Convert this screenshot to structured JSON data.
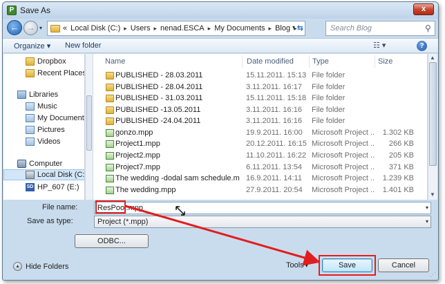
{
  "window": {
    "title": "Save As",
    "app_icon_letter": "P",
    "close_label": "x"
  },
  "address_bar": {
    "history_glyph": "«",
    "path": [
      "Local Disk (C:)",
      "Users",
      "nenad.ESCA",
      "My Documents",
      "Blog"
    ],
    "separator": "▸"
  },
  "search": {
    "placeholder": "Search Blog"
  },
  "toolbar": {
    "organize_label": "Organize ▾",
    "new_folder_label": "New folder",
    "views_label": "☷ ▾",
    "help_label": "?"
  },
  "nav_pane": {
    "items": [
      {
        "label": "Dropbox",
        "icon": "folder-icon"
      },
      {
        "label": "Recent Places",
        "icon": "recent-places-icon"
      },
      {
        "label": "Libraries",
        "icon": "libraries-icon"
      },
      {
        "label": "Music",
        "icon": "music-icon"
      },
      {
        "label": "My Documents",
        "icon": "documents-icon"
      },
      {
        "label": "Pictures",
        "icon": "pictures-icon"
      },
      {
        "label": "Videos",
        "icon": "videos-icon"
      },
      {
        "label": "Computer",
        "icon": "computer-icon"
      },
      {
        "label": "Local Disk (C:)",
        "icon": "local-disk-icon"
      },
      {
        "label": "HP_607 (E:)",
        "icon": "sd-card-icon"
      }
    ],
    "sd_badge": "SD"
  },
  "columns": {
    "name": "Name",
    "date": "Date modified",
    "type": "Type",
    "size": "Size"
  },
  "files": [
    {
      "name": "PUBLISHED - 28.03.2011",
      "date": "15.11.2011. 15:13",
      "type": "File folder",
      "size": "",
      "icon": "folder-icon"
    },
    {
      "name": "PUBLISHED - 28.04.2011",
      "date": "3.11.2011. 16:17",
      "type": "File folder",
      "size": "",
      "icon": "folder-icon"
    },
    {
      "name": "PUBLISHED - 31.03.2011",
      "date": "15.11.2011. 15:18",
      "type": "File folder",
      "size": "",
      "icon": "folder-icon"
    },
    {
      "name": "PUBLISHED -13.05.2011",
      "date": "3.11.2011. 16:16",
      "type": "File folder",
      "size": "",
      "icon": "folder-icon"
    },
    {
      "name": "PUBLISHED -24.04.2011",
      "date": "3.11.2011. 16:16",
      "type": "File folder",
      "size": "",
      "icon": "folder-icon"
    },
    {
      "name": "gonzo.mpp",
      "date": "19.9.2011. 16:00",
      "type": "Microsoft Project ...",
      "size": "1.302 KB",
      "icon": "project-file-icon"
    },
    {
      "name": "Project1.mpp",
      "date": "20.12.2011. 16:15",
      "type": "Microsoft Project ...",
      "size": "266 KB",
      "icon": "project-file-icon"
    },
    {
      "name": "Project2.mpp",
      "date": "11.10.2011. 16:22",
      "type": "Microsoft Project ...",
      "size": "205 KB",
      "icon": "project-file-icon"
    },
    {
      "name": "Project7.mpp",
      "date": "6.11.2011. 13:54",
      "type": "Microsoft Project ...",
      "size": "371 KB",
      "icon": "project-file-icon"
    },
    {
      "name": "The wedding -dodal sam schedule.mpp",
      "date": "16.9.2011. 14:11",
      "type": "Microsoft Project ...",
      "size": "1.239 KB",
      "icon": "project-file-icon"
    },
    {
      "name": "The wedding.mpp",
      "date": "27.9.2011. 20:54",
      "type": "Microsoft Project ...",
      "size": "1.401 KB",
      "icon": "project-file-icon"
    }
  ],
  "form": {
    "file_name_label": "File name:",
    "file_name_value": "ResPool.mpp",
    "save_type_label": "Save as type:",
    "save_type_value": "Project (*.mpp)",
    "dropdown_glyph": "▾"
  },
  "buttons": {
    "odbc": "ODBC...",
    "save": "Save",
    "cancel": "Cancel",
    "tools": "Tools",
    "hide_folders": "Hide Folders"
  },
  "colors": {
    "annotation_red": "#e21d1d",
    "window_frame": "#c9dced",
    "save_button": "#bee6fd"
  }
}
